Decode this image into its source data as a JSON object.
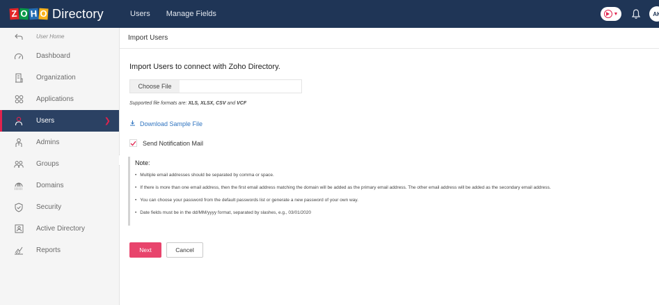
{
  "app": {
    "logo_letters": [
      "Z",
      "O",
      "H",
      "O"
    ],
    "name": "Directory"
  },
  "topnav": {
    "items": [
      {
        "label": "Users"
      },
      {
        "label": "Manage Fields"
      }
    ]
  },
  "top_right": {
    "avatar_initials": "AK",
    "icons": [
      "action-pill-icon",
      "bell-icon",
      "avatar"
    ]
  },
  "sidebar": {
    "items": [
      {
        "label": "User Home",
        "icon": "back-arrow-icon"
      },
      {
        "label": "Dashboard",
        "icon": "gauge-icon"
      },
      {
        "label": "Organization",
        "icon": "building-icon"
      },
      {
        "label": "Applications",
        "icon": "apps-grid-icon"
      },
      {
        "label": "Users",
        "icon": "user-icon",
        "active": true
      },
      {
        "label": "Admins",
        "icon": "admin-icon"
      },
      {
        "label": "Groups",
        "icon": "groups-icon"
      },
      {
        "label": "Domains",
        "icon": "domains-icon"
      },
      {
        "label": "Security",
        "icon": "shield-icon"
      },
      {
        "label": "Active Directory",
        "icon": "active-directory-icon"
      },
      {
        "label": "Reports",
        "icon": "reports-icon"
      }
    ]
  },
  "page": {
    "header": "Import Users",
    "title": "Import Users to connect with Zoho Directory.",
    "choose_file_label": "Choose File",
    "formats_prefix": "Supported file formats are: ",
    "formats": "XLS, XLSX, CSV",
    "formats_and": " and ",
    "formats_last": "VCF",
    "download_sample_label": "Download Sample File",
    "send_notification_label": "Send Notification Mail",
    "send_notification_checked": true,
    "note": {
      "title": "Note:",
      "items": [
        "Multiple email addresses should be separated by comma or space.",
        "If there is more than one email address, then the first email address matching the domain will be added as the primary email address. The other email address will be added as the secondary email address.",
        "You can choose your password from the default passwords list or generate a new password of your own way.",
        "Date fields must be in the dd/MM/yyyy format, separated by slashes, e.g., 03/01/2020"
      ]
    },
    "next_label": "Next",
    "cancel_label": "Cancel"
  },
  "colors": {
    "topbar": "#1f3556",
    "active_sidebar": "#2b4163",
    "accent": "#e0234e",
    "next_button": "#e8446c",
    "link": "#2f74c0"
  }
}
